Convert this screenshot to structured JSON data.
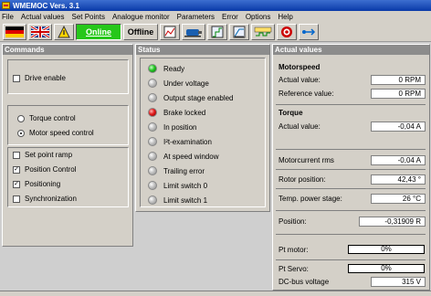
{
  "window": {
    "title": "WMEMOC Vers. 3.1"
  },
  "menu": [
    "File",
    "Actual values",
    "Set Points",
    "Analogue monitor",
    "Parameters",
    "Error",
    "Options",
    "Help"
  ],
  "toolbar": {
    "online_label": "Online",
    "offline_label": "Offline",
    "icons": [
      "german-flag-icon",
      "uk-flag-icon",
      "warning-hand-icon",
      "online-button",
      "offline-button",
      "chart-icon",
      "motor-icon",
      "step-chart-icon",
      "ramp-chart-icon",
      "digital-io-icon",
      "target-icon",
      "arrow-right-icon"
    ],
    "online_color": "#26c71a"
  },
  "commands": {
    "title": "Commands",
    "drive_enable": {
      "label": "Drive enable",
      "checked": false
    },
    "modes": [
      {
        "label": "Torque control",
        "selected": false
      },
      {
        "label": "Motor speed control",
        "selected": true
      }
    ],
    "options": [
      {
        "label": "Set point ramp",
        "checked": false
      },
      {
        "label": "Position Control",
        "checked": true
      },
      {
        "label": "Positioning",
        "checked": true
      },
      {
        "label": "Synchronization",
        "checked": false
      }
    ]
  },
  "status": {
    "title": "Status",
    "items": [
      {
        "label": "Ready",
        "state": "green"
      },
      {
        "label": "Under voltage",
        "state": "off"
      },
      {
        "label": "Output stage enabled",
        "state": "off"
      },
      {
        "label": "Brake locked",
        "state": "red"
      },
      {
        "label": "In position",
        "state": "off"
      },
      {
        "label": "I²t-examination",
        "state": "off"
      },
      {
        "label": "At speed window",
        "state": "off"
      },
      {
        "label": "Trailing error",
        "state": "off"
      },
      {
        "label": "Limit switch 0",
        "state": "off"
      },
      {
        "label": "Limit switch 1",
        "state": "off"
      }
    ]
  },
  "actual": {
    "title": "Actual values",
    "motorspeed_header": "Motorspeed",
    "actual_speed_label": "Actual value:",
    "actual_speed_value": "0 RPM",
    "reference_label": "Reference value:",
    "reference_value": "0 RPM",
    "torque_header": "Torque",
    "torque_label": "Actual value:",
    "torque_value": "-0,04 A",
    "motorcurrent_label": "Motorcurrent rms",
    "motorcurrent_value": "-0,04 A",
    "rotor_label": "Rotor position:",
    "rotor_value": "42,43 °",
    "temp_label": "Temp. power stage:",
    "temp_value": "26 °C",
    "position_label": "Position:",
    "position_value": "-0,31909  R",
    "pt_motor_label": "Pt motor:",
    "pt_motor_value": "0%",
    "pt_servo_label": "Pt Servo:",
    "pt_servo_value": "0%",
    "dcbus_label": "DC-bus voltage",
    "dcbus_value": "315 V"
  }
}
